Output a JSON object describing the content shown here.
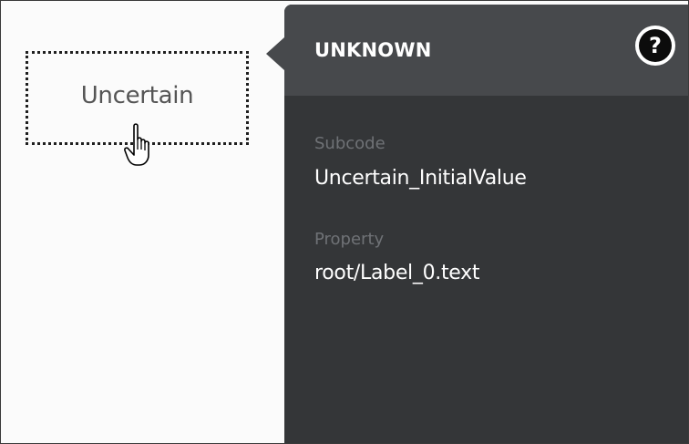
{
  "canvas": {
    "label_text": "Uncertain",
    "cursor_icon": "hand-pointer-icon"
  },
  "quality_panel": {
    "title": "UNKNOWN",
    "help_icon": "question-circle-icon",
    "help_glyph": "?",
    "fields": [
      {
        "label": "Subcode",
        "value": "Uncertain_InitialValue"
      },
      {
        "label": "Property",
        "value": "root/Label_0.text"
      }
    ]
  },
  "colors": {
    "panel_background": "#343638",
    "panel_header": "#47494c",
    "muted_label": "#6f7276",
    "label_text": "#555555"
  }
}
